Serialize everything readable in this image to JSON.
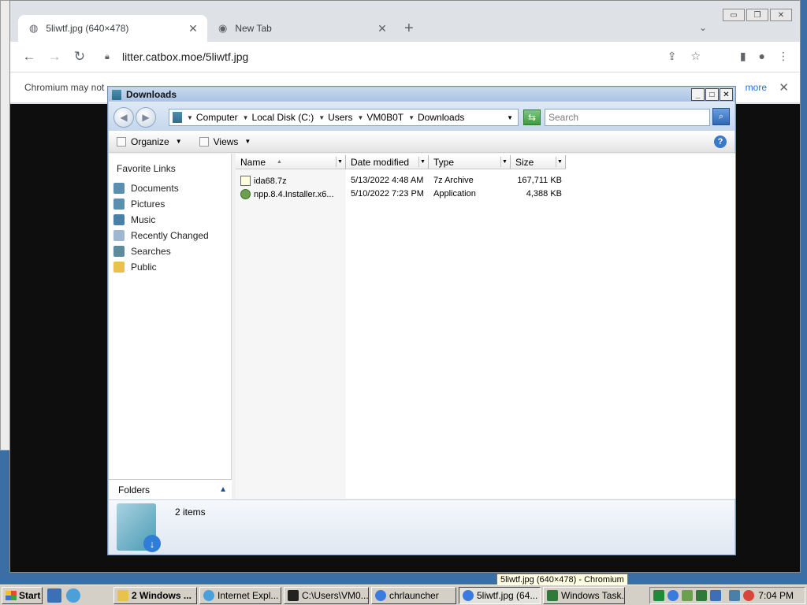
{
  "browser": {
    "tabs": [
      {
        "title": "5liwtf.jpg (640×478)",
        "close": "✕"
      },
      {
        "title": "New Tab",
        "close": "✕"
      }
    ],
    "new_tab": "+",
    "tab_dropdown": "⌄",
    "window_controls": {
      "minimize": "▭",
      "restore": "❐",
      "close": "✕"
    },
    "nav": {
      "back": "←",
      "forward": "→",
      "reload": "↻"
    },
    "url": "litter.catbox.moe/5liwtf.jpg",
    "infobar": {
      "message": "Chromium may not",
      "more_link": "more",
      "close": "✕"
    }
  },
  "explorer": {
    "title": "Downloads",
    "controls": {
      "minimize": "_",
      "maximize": "□",
      "close": "✕"
    },
    "breadcrumbs": [
      "Computer",
      "Local Disk (C:)",
      "Users",
      "VM0B0T",
      "Downloads"
    ],
    "search_placeholder": "Search",
    "commands": {
      "organize": "Organize",
      "views": "Views"
    },
    "help": "?",
    "favorite_links_title": "Favorite Links",
    "favorites": [
      "Documents",
      "Pictures",
      "Music",
      "Recently Changed",
      "Searches",
      "Public"
    ],
    "folders_label": "Folders",
    "columns": {
      "name": "Name",
      "date": "Date modified",
      "type": "Type",
      "size": "Size"
    },
    "files": [
      {
        "name": "ida68.7z",
        "date": "5/13/2022 4:48 AM",
        "type": "7z Archive",
        "size": "167,711 KB"
      },
      {
        "name": "npp.8.4.Installer.x6...",
        "date": "5/10/2022 7:23 PM",
        "type": "Application",
        "size": "4,388 KB"
      }
    ],
    "item_count": "2 items"
  },
  "tooltip": "5liwtf.jpg (640×478) - Chromium",
  "taskbar": {
    "start": "Start",
    "tasks": [
      {
        "label": "2 Windows ...",
        "pressed": false
      },
      {
        "label": "Internet Expl...",
        "pressed": false
      },
      {
        "label": "C:\\Users\\VM0...",
        "pressed": false
      },
      {
        "label": "chrlauncher",
        "pressed": false
      },
      {
        "label": "5liwtf.jpg (64...",
        "pressed": true
      },
      {
        "label": "Windows Task...",
        "pressed": false
      }
    ],
    "clock": "7:04 PM"
  },
  "colors": {
    "taskbar": "#d4d0c8",
    "desktop": "#3a6ea5",
    "link": "#1a73e8"
  }
}
